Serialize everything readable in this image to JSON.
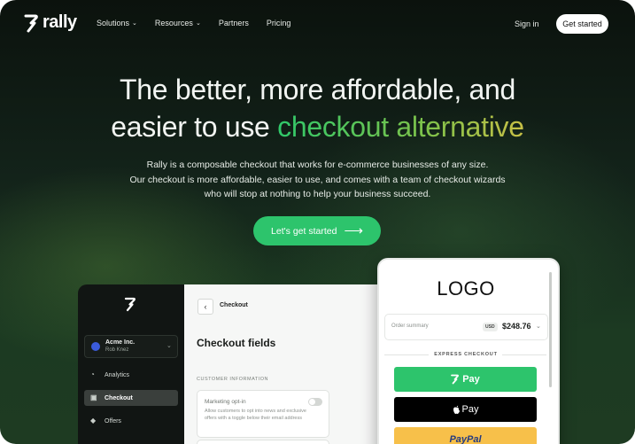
{
  "nav": {
    "brand": "rally",
    "links": [
      {
        "label": "Solutions",
        "has_dropdown": true
      },
      {
        "label": "Resources",
        "has_dropdown": true
      },
      {
        "label": "Partners",
        "has_dropdown": false
      },
      {
        "label": "Pricing",
        "has_dropdown": false
      }
    ],
    "signin": "Sign in",
    "cta": "Get started"
  },
  "hero": {
    "headline_line1": "The better, more affordable, and",
    "headline_line2_plain": "easier to use ",
    "headline_line2_accent": "checkout alternative",
    "sub_line1": "Rally is a composable checkout that works for e-commerce businesses of any size.",
    "sub_line2": "Our checkout is more affordable, easier to use, and comes with a team of checkout wizards",
    "sub_line3": "who will stop at nothing to help your business succeed.",
    "cta": "Let's get started",
    "cta_icon": "arrow-right-icon"
  },
  "dashboard": {
    "account_name": "Acme Inc.",
    "account_user": "Rob Knez",
    "sidebar": [
      {
        "label": "Analytics",
        "icon": "pie-chart-icon",
        "active": false
      },
      {
        "label": "Checkout",
        "icon": "cart-icon",
        "active": true
      },
      {
        "label": "Offers",
        "icon": "tag-icon",
        "active": false
      }
    ],
    "breadcrumb": "Checkout",
    "title": "Checkout fields",
    "section_label": "CUSTOMER INFORMATION",
    "option_title": "Marketing opt-in",
    "option_desc": "Allow customers to opt into news and exclusive offers with a toggle below their email address",
    "option_enabled": false
  },
  "phone": {
    "logo": "LOGO",
    "order_label": "Order summary",
    "currency": "USD",
    "total": "$248.76",
    "express_label": "EXPRESS CHECKOUT",
    "pay_rally": "Pay",
    "pay_apple": "Pay",
    "pay_paypal": "PayPal"
  },
  "colors": {
    "accent_green": "#2dc46c",
    "paypal_yellow": "#f7c04a",
    "background_dark": "#13231a"
  }
}
